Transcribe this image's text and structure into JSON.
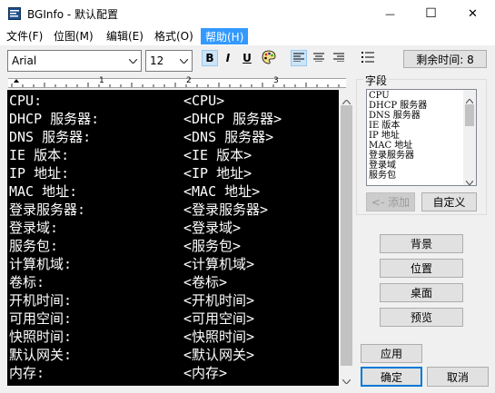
{
  "window": {
    "title": "BGInfo - 默认配置",
    "minimize_glyph": "—",
    "maximize_glyph": "☐",
    "close_glyph": "✕"
  },
  "menu": [
    {
      "label": "文件(F)"
    },
    {
      "label": "位图(M)"
    },
    {
      "label": "编辑(E)"
    },
    {
      "label": "格式(O)"
    },
    {
      "label": "帮助(H)"
    }
  ],
  "toolbar": {
    "font": "Arial",
    "size": "12",
    "bold": "B",
    "italic": "I",
    "underline": "U",
    "remaining_label": "剩余时间: 8"
  },
  "ruler": {
    "mark1": "1",
    "mark2": "2",
    "mark3": "3"
  },
  "editor_rows": [
    {
      "label": "CPU:",
      "value": "<CPU>"
    },
    {
      "label": "DHCP 服务器:",
      "value": "<DHCP 服务器>"
    },
    {
      "label": "DNS 服务器:",
      "value": "<DNS 服务器>"
    },
    {
      "label": "IE 版本:",
      "value": "<IE 版本>"
    },
    {
      "label": "IP 地址:",
      "value": "<IP 地址>"
    },
    {
      "label": "MAC 地址:",
      "value": "<MAC 地址>"
    },
    {
      "label": "登录服务器:",
      "value": "<登录服务器>"
    },
    {
      "label": "登录域:",
      "value": "<登录域>"
    },
    {
      "label": "服务包:",
      "value": "<服务包>"
    },
    {
      "label": "计算机域:",
      "value": "<计算机域>"
    },
    {
      "label": "卷标:",
      "value": "<卷标>"
    },
    {
      "label": "开机时间:",
      "value": "<开机时间>"
    },
    {
      "label": "可用空间:",
      "value": "<可用空间>"
    },
    {
      "label": "快照时间:",
      "value": "<快照时间>"
    },
    {
      "label": "默认网关:",
      "value": "<默认网关>"
    },
    {
      "label": "内存:",
      "value": "<内存>"
    }
  ],
  "fields": {
    "label": "字段",
    "items": [
      "CPU",
      "DHCP 服务器",
      "DNS 服务器",
      "IE 版本",
      "IP 地址",
      "MAC 地址",
      "登录服务器",
      "登录域",
      "服务包"
    ],
    "add_label": "<- 添加",
    "custom_label": "自定义"
  },
  "buttons": {
    "background": "背景",
    "position": "位置",
    "desktop": "桌面",
    "preview": "预览",
    "apply": "应用",
    "ok": "确定",
    "cancel": "取消"
  }
}
